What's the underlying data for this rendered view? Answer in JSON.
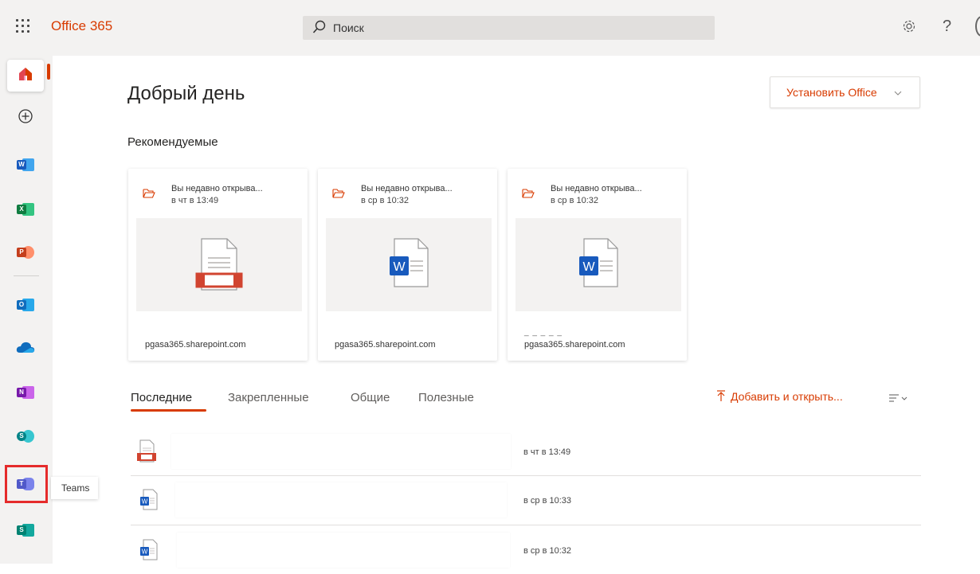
{
  "header": {
    "app_title": "Office 365",
    "search_placeholder": "Поиск",
    "help_glyph": "?"
  },
  "rail": {
    "items": [
      {
        "name": "home-icon"
      },
      {
        "name": "create-icon"
      },
      {
        "name": "word-icon",
        "letter": "W",
        "color": "#185abd"
      },
      {
        "name": "excel-icon",
        "letter": "X",
        "color": "#107c41"
      },
      {
        "name": "powerpoint-icon",
        "letter": "P",
        "color": "#c43e1c"
      },
      {
        "name": "outlook-icon",
        "letter": "O",
        "color": "#0f6cbd"
      },
      {
        "name": "onedrive-icon"
      },
      {
        "name": "onenote-icon",
        "letter": "N",
        "color": "#7719aa"
      },
      {
        "name": "sharepoint-icon",
        "letter": "S",
        "color": "#038387"
      },
      {
        "name": "teams-icon",
        "letter": "T",
        "color": "#5059c9"
      },
      {
        "name": "sway-icon",
        "letter": "S",
        "color": "#008272"
      }
    ],
    "tooltip": "Teams"
  },
  "main": {
    "greeting": "Добрый день",
    "install_button": "Установить Office",
    "recommended_title": "Рекомендуемые",
    "cards": [
      {
        "line1": "Вы недавно открыва...",
        "line2": "в чт в 13:49",
        "site": "pgasa365.sharepoint.com",
        "type": "pdf"
      },
      {
        "line1": "Вы недавно открыва...",
        "line2": "в ср в 10:32",
        "site": "pgasa365.sharepoint.com",
        "type": "word"
      },
      {
        "line1": "Вы недавно открыва...",
        "line2": "в ср в 10:32",
        "site": "pgasa365.sharepoint.com",
        "type": "word",
        "dashes": "_ _    _    _        _"
      }
    ],
    "tabs": [
      "Последние",
      "Закрепленные",
      "Общие",
      "Полезные"
    ],
    "active_tab": "Последние",
    "add_open": "Добавить и открыть...",
    "files": [
      {
        "type": "pdf",
        "time": "в чт в 13:49"
      },
      {
        "type": "word",
        "time": "в ср в 10:33"
      },
      {
        "type": "word",
        "time": "в ср в 10:32"
      }
    ]
  },
  "colors": {
    "accent": "#d83b01",
    "highlight_box": "#e52b2b"
  }
}
